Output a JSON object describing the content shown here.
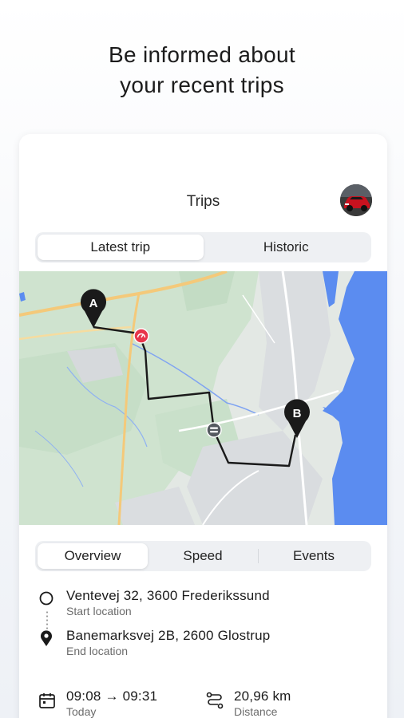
{
  "headline": {
    "line1": "Be informed about",
    "line2": "your recent trips"
  },
  "header": {
    "title": "Trips",
    "avatar_icon": "car-avatar"
  },
  "trip_tabs": {
    "items": [
      {
        "label": "Latest trip",
        "active": true
      },
      {
        "label": "Historic",
        "active": false
      }
    ]
  },
  "map": {
    "start_marker": "A",
    "end_marker": "B",
    "event_icons": [
      "speed-event-icon",
      "brake-event-icon"
    ],
    "water_color": "#5b8cf0",
    "route_color": "#1a1a1a",
    "event_color": "#e8364b"
  },
  "detail_tabs": {
    "items": [
      {
        "label": "Overview",
        "active": true
      },
      {
        "label": "Speed",
        "active": false
      },
      {
        "label": "Events",
        "active": false
      }
    ]
  },
  "start": {
    "address": "Ventevej 32, 3600 Frederikssund",
    "caption": "Start location"
  },
  "end": {
    "address": "Banemarksvej 2B, 2600 Glostrup",
    "caption": "End location"
  },
  "time": {
    "value": "09:08 → 09:31",
    "caption": "Today"
  },
  "distance": {
    "value": "20,96 km",
    "caption": "Distance"
  }
}
